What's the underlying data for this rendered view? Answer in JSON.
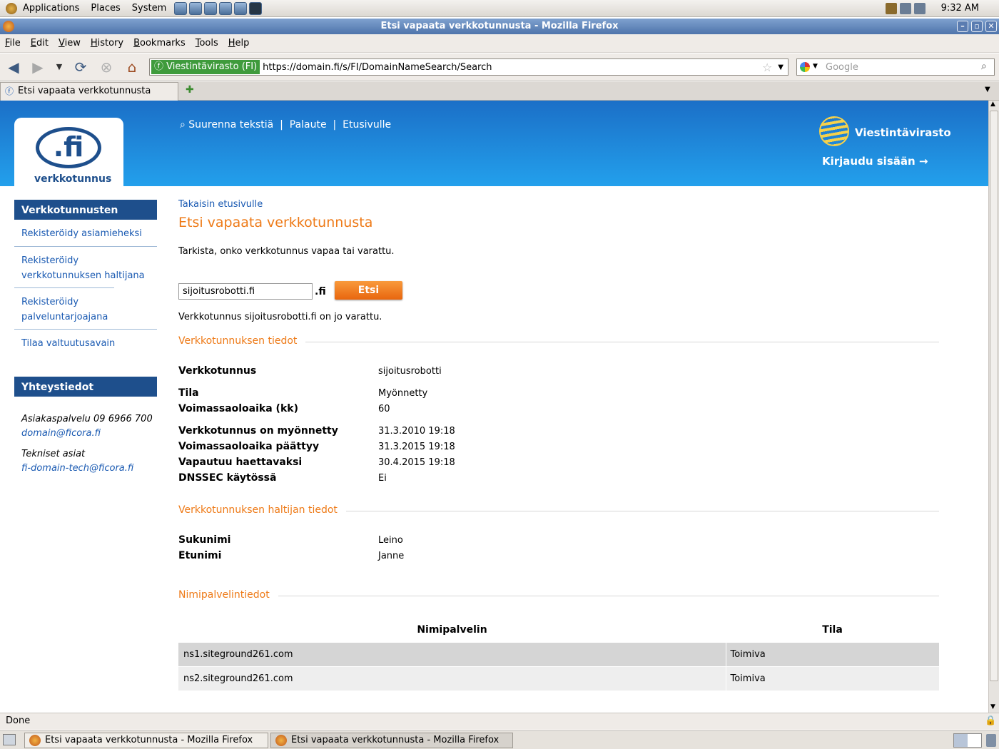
{
  "panel": {
    "menus": [
      "Applications",
      "Places",
      "System"
    ],
    "clock": "9:32 AM"
  },
  "window": {
    "title": "Etsi vapaata verkkotunnusta - Mozilla Firefox"
  },
  "menubar": [
    "File",
    "Edit",
    "View",
    "History",
    "Bookmarks",
    "Tools",
    "Help"
  ],
  "nav": {
    "identity": "Viestintävirasto (FI)",
    "url": "https://domain.fi/s/FI/DomainNameSearch/Search",
    "search_placeholder": "Google"
  },
  "tab": {
    "label": "Etsi vapaata verkkotunnusta"
  },
  "banner": {
    "logo_text": ".fi",
    "logo_caption": "verkkotunnus",
    "links": [
      "Suurenna tekstiä",
      "Palaute",
      "Etusivulle"
    ],
    "brand": "Viestintävirasto",
    "login": "Kirjaudu sisään"
  },
  "sidebar": {
    "nav_header": "Verkkotunnusten hallinta",
    "items": [
      "Rekisteröidy asiamieheksi",
      "Rekisteröidy verkkotunnuksen haltijana",
      "Rekisteröidy palveluntarjoajana",
      "Tilaa valtuutusavain"
    ],
    "contact_header": "Yhteystiedot",
    "contact": {
      "service": "Asiakaspalvelu 09 6966 700",
      "service_email": "domain@ficora.fi",
      "tech_label": "Tekniset asiat",
      "tech_email": "fi-domain-tech@ficora.fi"
    }
  },
  "main": {
    "back": "Takaisin etusivulle",
    "title": "Etsi vapaata verkkotunnusta",
    "intro": "Tarkista, onko verkkotunnus vapaa tai varattu.",
    "search_value": "sijoitusrobotti.fi",
    "suffix": ".fi",
    "search_button": "Etsi",
    "result": "Verkkotunnus sijoitusrobotti.fi on jo varattu.",
    "domain_section": "Verkkotunnuksen tiedot",
    "domain_rows": [
      {
        "label": "Verkkotunnus",
        "value": "sijoitusrobotti"
      },
      {
        "label": "Tila",
        "value": "Myönnetty"
      },
      {
        "label": "Voimassaoloaika (kk)",
        "value": "60"
      },
      {
        "label": "Verkkotunnus on myönnetty",
        "value": "31.3.2010 19:18"
      },
      {
        "label": "Voimassaoloaika päättyy",
        "value": "31.3.2015 19:18"
      },
      {
        "label": "Vapautuu haettavaksi",
        "value": "30.4.2015 19:18"
      },
      {
        "label": "DNSSEC käytössä",
        "value": "Ei"
      }
    ],
    "holder_section": "Verkkotunnuksen haltijan tiedot",
    "holder_rows": [
      {
        "label": "Sukunimi",
        "value": "Leino"
      },
      {
        "label": "Etunimi",
        "value": "Janne"
      }
    ],
    "ns_section": "Nimipalvelintiedot",
    "ns_headers": [
      "Nimipalvelin",
      "Tila"
    ],
    "ns_rows": [
      {
        "server": "ns1.siteground261.com",
        "status": "Toimiva"
      },
      {
        "server": "ns2.siteground261.com",
        "status": "Toimiva"
      }
    ]
  },
  "status": "Done",
  "taskbar": [
    "Etsi vapaata verkkotunnusta - Mozilla Firefox",
    "Etsi vapaata verkkotunnusta - Mozilla Firefox"
  ]
}
